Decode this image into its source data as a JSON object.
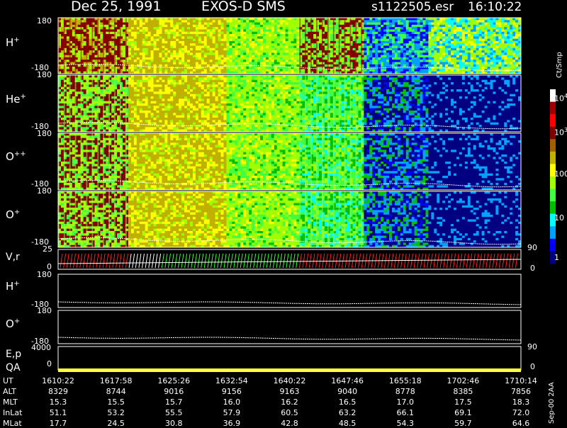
{
  "header": {
    "date": "Dec 25, 1991",
    "instrument": "EXOS-D SMS",
    "file": "s1122505.esr",
    "time": "16:10:22"
  },
  "colorbar": {
    "unit": "Ct/Smp",
    "ticks": [
      "10",
      "100",
      "10",
      "10"
    ],
    "tick_sups": [
      "4",
      "",
      "3",
      ""
    ],
    "tick_plain": [
      "1",
      "10",
      "100"
    ],
    "colors": [
      "#000080",
      "#0000ff",
      "#00a0ff",
      "#00ffff",
      "#00c000",
      "#40ff40",
      "#a0ff00",
      "#ffff00",
      "#c0b000",
      "#a06000",
      "#800000",
      "#ff0000",
      "#a00000",
      "#ffffff"
    ]
  },
  "panels": [
    {
      "name": "H",
      "sup": "+",
      "top": "180",
      "bottom": "-180"
    },
    {
      "name": "He",
      "sup": "+",
      "top": "180",
      "bottom": "-180"
    },
    {
      "name": "O",
      "sup": "++",
      "top": "180",
      "bottom": "-180"
    },
    {
      "name": "O",
      "sup": "+",
      "top": "180",
      "bottom": "-180"
    }
  ],
  "vr_panel": {
    "label": "V,r",
    "top": "25",
    "bottom": "0",
    "right_top": "90",
    "right_bottom": "0"
  },
  "line_panels": [
    {
      "name": "H",
      "sup": "+",
      "top": "180",
      "bottom": "-180"
    },
    {
      "name": "O",
      "sup": "+",
      "top": "180",
      "bottom": "-180"
    }
  ],
  "ep_panel": {
    "label": "E,p",
    "top": "4000",
    "right_top": "90"
  },
  "qa_panel": {
    "label": "QA",
    "bottom": "0",
    "right_bottom": "0"
  },
  "footer_rows": [
    {
      "label": "UT",
      "values": [
        "1610:22",
        "1617:58",
        "1625:26",
        "1632:54",
        "1640:22",
        "1647:46",
        "1655:18",
        "1702:46",
        "1710:14"
      ]
    },
    {
      "label": "ALT",
      "values": [
        "8329",
        "8744",
        "9016",
        "9156",
        "9163",
        "9040",
        "8778",
        "8385",
        "7856"
      ]
    },
    {
      "label": "MLT",
      "values": [
        "15.3",
        "15.5",
        "15.7",
        "16.0",
        "16.2",
        "16.5",
        "17.0",
        "17.5",
        "18.3"
      ]
    },
    {
      "label": "InLat",
      "values": [
        "51.1",
        "53.2",
        "55.5",
        "57.9",
        "60.5",
        "63.2",
        "66.1",
        "69.1",
        "72.0"
      ]
    },
    {
      "label": "MLat",
      "values": [
        "17.7",
        "24.5",
        "30.8",
        "36.9",
        "42.8",
        "48.5",
        "54.3",
        "59.7",
        "64.6"
      ]
    }
  ],
  "side_note": "Sep-00 2AA",
  "chart_data": {
    "type": "heatmap",
    "title": "Dec 25, 1991   EXOS-D SMS",
    "x": [
      "1610:22",
      "1617:58",
      "1625:26",
      "1632:54",
      "1640:22",
      "1647:46",
      "1655:18",
      "1702:46",
      "1710:14"
    ],
    "xlabel": "UT",
    "series": [
      {
        "name": "H+",
        "ylim": [
          -180,
          180
        ]
      },
      {
        "name": "He+",
        "ylim": [
          -180,
          180
        ]
      },
      {
        "name": "O++",
        "ylim": [
          -180,
          180
        ]
      },
      {
        "name": "O+",
        "ylim": [
          -180,
          180
        ]
      }
    ],
    "color_scale": {
      "unit": "Ct/Smp",
      "range": [
        1,
        10000
      ],
      "log": true
    }
  }
}
